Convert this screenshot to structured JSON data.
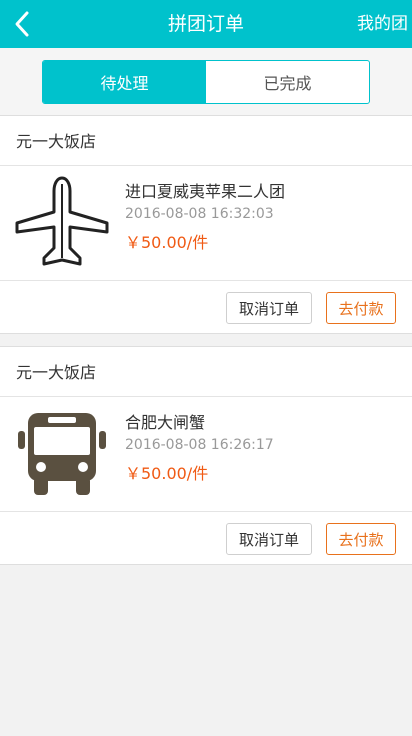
{
  "header": {
    "title": "拼团订单",
    "right_label": "我的团",
    "back_icon": "chevron-left-icon"
  },
  "tabs": [
    {
      "label": "待处理",
      "active": true
    },
    {
      "label": "已完成",
      "active": false
    }
  ],
  "orders": [
    {
      "shop": "元一大饭店",
      "icon": "airplane-icon",
      "name": "进口夏威夷苹果二人团",
      "time": "2016-08-08 16:32:03",
      "price": "￥50.00/件",
      "cancel_label": "取消订单",
      "pay_label": "去付款"
    },
    {
      "shop": "元一大饭店",
      "icon": "bus-icon",
      "name": "合肥大闸蟹",
      "time": "2016-08-08 16:26:17",
      "price": "￥50.00/件",
      "cancel_label": "取消订单",
      "pay_label": "去付款"
    }
  ],
  "colors": {
    "primary": "#00c2cc",
    "price": "#f05a14",
    "pay_button": "#e8711c",
    "icon_dark": "#5a5040"
  }
}
